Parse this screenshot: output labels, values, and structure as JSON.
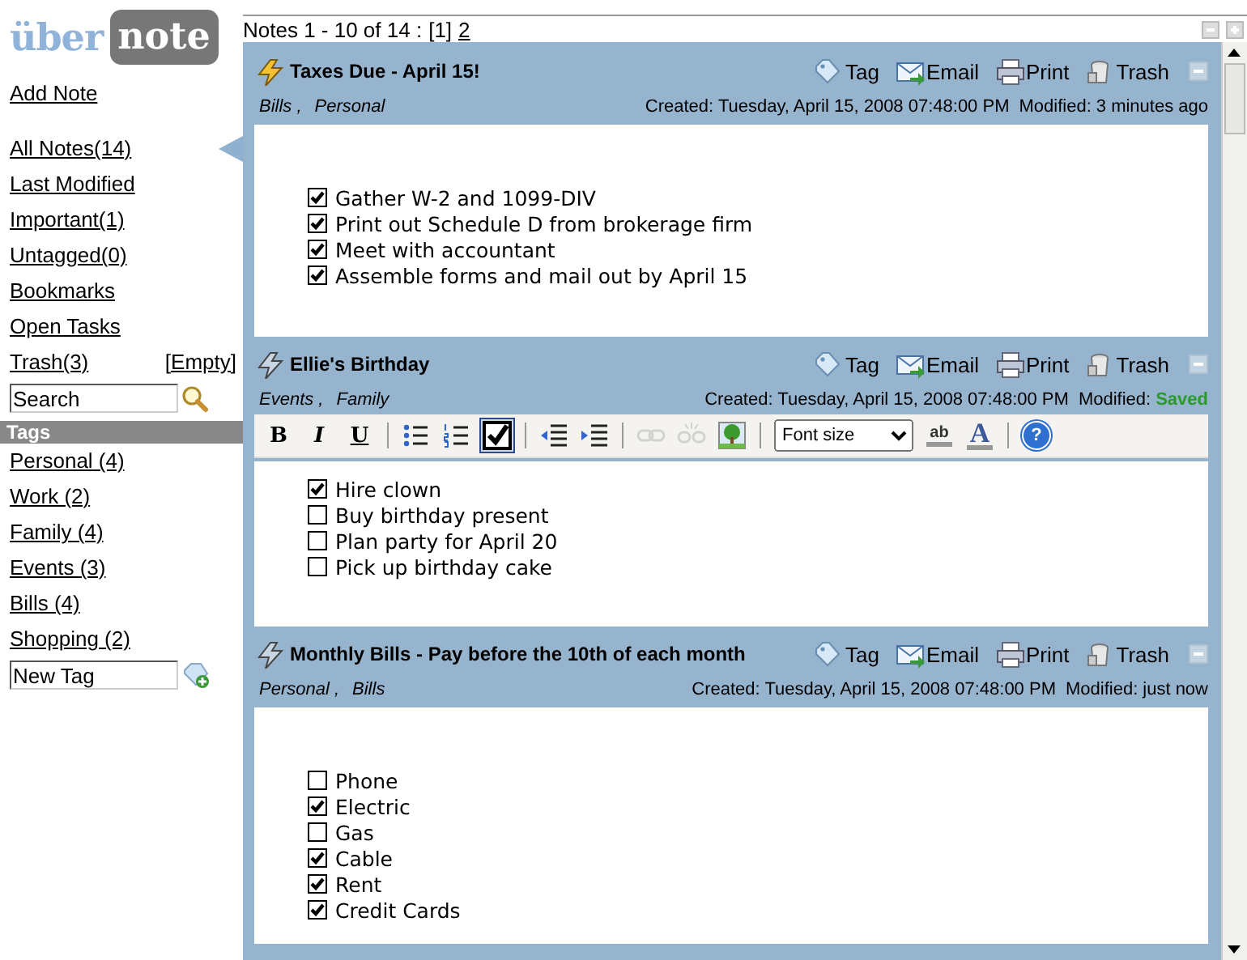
{
  "sidebar": {
    "logo": {
      "part_1": "über",
      "part_2": "note"
    },
    "add_note": "Add Note",
    "nav": [
      {
        "label": "All Notes(14)",
        "selected": true
      },
      {
        "label": "Last Modified",
        "selected": false
      },
      {
        "label": "Important(1)",
        "selected": false
      },
      {
        "label": "Untagged(0)",
        "selected": false
      },
      {
        "label": "Bookmarks",
        "selected": false
      },
      {
        "label": "Open Tasks",
        "selected": false
      }
    ],
    "trash": {
      "label": "Trash(3)",
      "empty": "[Empty]"
    },
    "search": {
      "value": "Search"
    },
    "tags_header": "Tags",
    "tags": [
      "Personal (4)",
      "Work (2)",
      "Family (4)",
      "Events (3)",
      "Bills (4)",
      "Shopping (2)"
    ],
    "new_tag": {
      "value": "New Tag"
    }
  },
  "pager": {
    "label": "Notes 1 - 10 of 14 :",
    "pages": [
      {
        "label": "[1]",
        "selected": true
      },
      {
        "label": "2",
        "selected": false
      }
    ]
  },
  "notes": [
    {
      "title": "Taxes Due - April 15!",
      "important": true,
      "actions": [
        "Tag",
        "Email",
        "Print",
        "Trash"
      ],
      "tags": [
        "Bills ,",
        "Personal"
      ],
      "created": "Created: Tuesday, April 15, 2008 07:48:00 PM",
      "modified_label": "Modified:",
      "modified": "3 minutes ago",
      "saved": false,
      "editing": false,
      "items": [
        {
          "text": "Gather W-2 and 1099-DIV",
          "checked": true
        },
        {
          "text": "Print out Schedule D from brokerage firm",
          "checked": true
        },
        {
          "text": "Meet with accountant",
          "checked": true
        },
        {
          "text": "Assemble forms and mail out by April 15",
          "checked": true
        }
      ]
    },
    {
      "title": "Ellie's Birthday",
      "important": false,
      "actions": [
        "Tag",
        "Email",
        "Print",
        "Trash"
      ],
      "tags": [
        "Events ,",
        "Family"
      ],
      "created": "Created: Tuesday, April 15, 2008 07:48:00 PM",
      "modified_label": "Modified:",
      "modified": "Saved",
      "saved": true,
      "editing": true,
      "items": [
        {
          "text": "Hire clown",
          "checked": true
        },
        {
          "text": "Buy birthday present",
          "checked": false
        },
        {
          "text": "Plan party for April 20",
          "checked": false
        },
        {
          "text": "Pick up birthday cake",
          "checked": false
        }
      ]
    },
    {
      "title": "Monthly Bills - Pay before the 10th of each month",
      "important": false,
      "actions": [
        "Tag",
        "Email",
        "Print",
        "Trash"
      ],
      "tags": [
        "Personal ,",
        "Bills"
      ],
      "created": "Created: Tuesday, April 15, 2008 07:48:00 PM",
      "modified_label": "Modified:",
      "modified": "just now",
      "saved": false,
      "editing": false,
      "items": [
        {
          "text": "Phone",
          "checked": false
        },
        {
          "text": "Electric",
          "checked": true
        },
        {
          "text": "Gas",
          "checked": false
        },
        {
          "text": "Cable",
          "checked": true
        },
        {
          "text": "Rent",
          "checked": true
        },
        {
          "text": "Credit Cards",
          "checked": true
        }
      ]
    }
  ],
  "toolbar": [
    {
      "kind": "bold",
      "label": "B",
      "disabled": false,
      "selected": false
    },
    {
      "kind": "italic",
      "label": "I",
      "disabled": false,
      "selected": false
    },
    {
      "kind": "underline",
      "label": "U",
      "disabled": false,
      "selected": false
    },
    {
      "kind": "sep"
    },
    {
      "kind": "bullets",
      "disabled": false,
      "selected": false
    },
    {
      "kind": "numbers",
      "disabled": false,
      "selected": false
    },
    {
      "kind": "checklist",
      "disabled": false,
      "selected": true
    },
    {
      "kind": "sep"
    },
    {
      "kind": "outdent",
      "disabled": false,
      "selected": false
    },
    {
      "kind": "indent",
      "disabled": false,
      "selected": false
    },
    {
      "kind": "sep"
    },
    {
      "kind": "link",
      "disabled": true,
      "selected": false
    },
    {
      "kind": "unlink",
      "disabled": true,
      "selected": false
    },
    {
      "kind": "image",
      "disabled": false,
      "selected": false
    },
    {
      "kind": "sep"
    },
    {
      "kind": "fontsize",
      "placeholder": "Font size"
    },
    {
      "kind": "highlight",
      "label": "ab",
      "disabled": false,
      "selected": false
    },
    {
      "kind": "color",
      "label": "A",
      "disabled": false,
      "selected": false
    },
    {
      "kind": "sep"
    },
    {
      "kind": "help",
      "label": "?",
      "disabled": false,
      "selected": false
    }
  ]
}
